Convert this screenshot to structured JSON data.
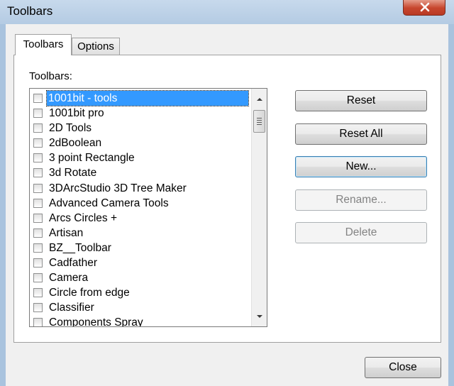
{
  "window": {
    "title": "Toolbars"
  },
  "tabs": [
    {
      "label": "Toolbars",
      "active": true
    },
    {
      "label": "Options",
      "active": false
    }
  ],
  "toolbars_group": {
    "label": "Toolbars:"
  },
  "toolbar_list": {
    "selected_index": 0,
    "items": [
      {
        "label": "1001bit - tools",
        "checked": false
      },
      {
        "label": "1001bit pro",
        "checked": false
      },
      {
        "label": "2D Tools",
        "checked": false
      },
      {
        "label": "2dBoolean",
        "checked": false
      },
      {
        "label": "3 point Rectangle",
        "checked": false
      },
      {
        "label": "3d Rotate",
        "checked": false
      },
      {
        "label": "3DArcStudio 3D Tree Maker",
        "checked": false
      },
      {
        "label": "Advanced Camera Tools",
        "checked": false
      },
      {
        "label": "Arcs Circles +",
        "checked": false
      },
      {
        "label": "Artisan",
        "checked": false
      },
      {
        "label": "BZ__Toolbar",
        "checked": false
      },
      {
        "label": "Cadfather",
        "checked": false
      },
      {
        "label": "Camera",
        "checked": false
      },
      {
        "label": "Circle from edge",
        "checked": false
      },
      {
        "label": "Classifier",
        "checked": false
      },
      {
        "label": "Components Spray",
        "checked": false
      }
    ]
  },
  "buttons": {
    "reset": "Reset",
    "reset_all": "Reset All",
    "new": "New...",
    "rename": "Rename...",
    "delete": "Delete",
    "close": "Close"
  },
  "icons": {
    "window_close": "close-icon",
    "scroll_up": "arrow-up-icon",
    "scroll_down": "arrow-down-icon",
    "thumb_grip": "grip-icon"
  },
  "colors": {
    "selection": "#3399ff",
    "title_close": "#c7472f",
    "frame": "#a9c3de"
  }
}
